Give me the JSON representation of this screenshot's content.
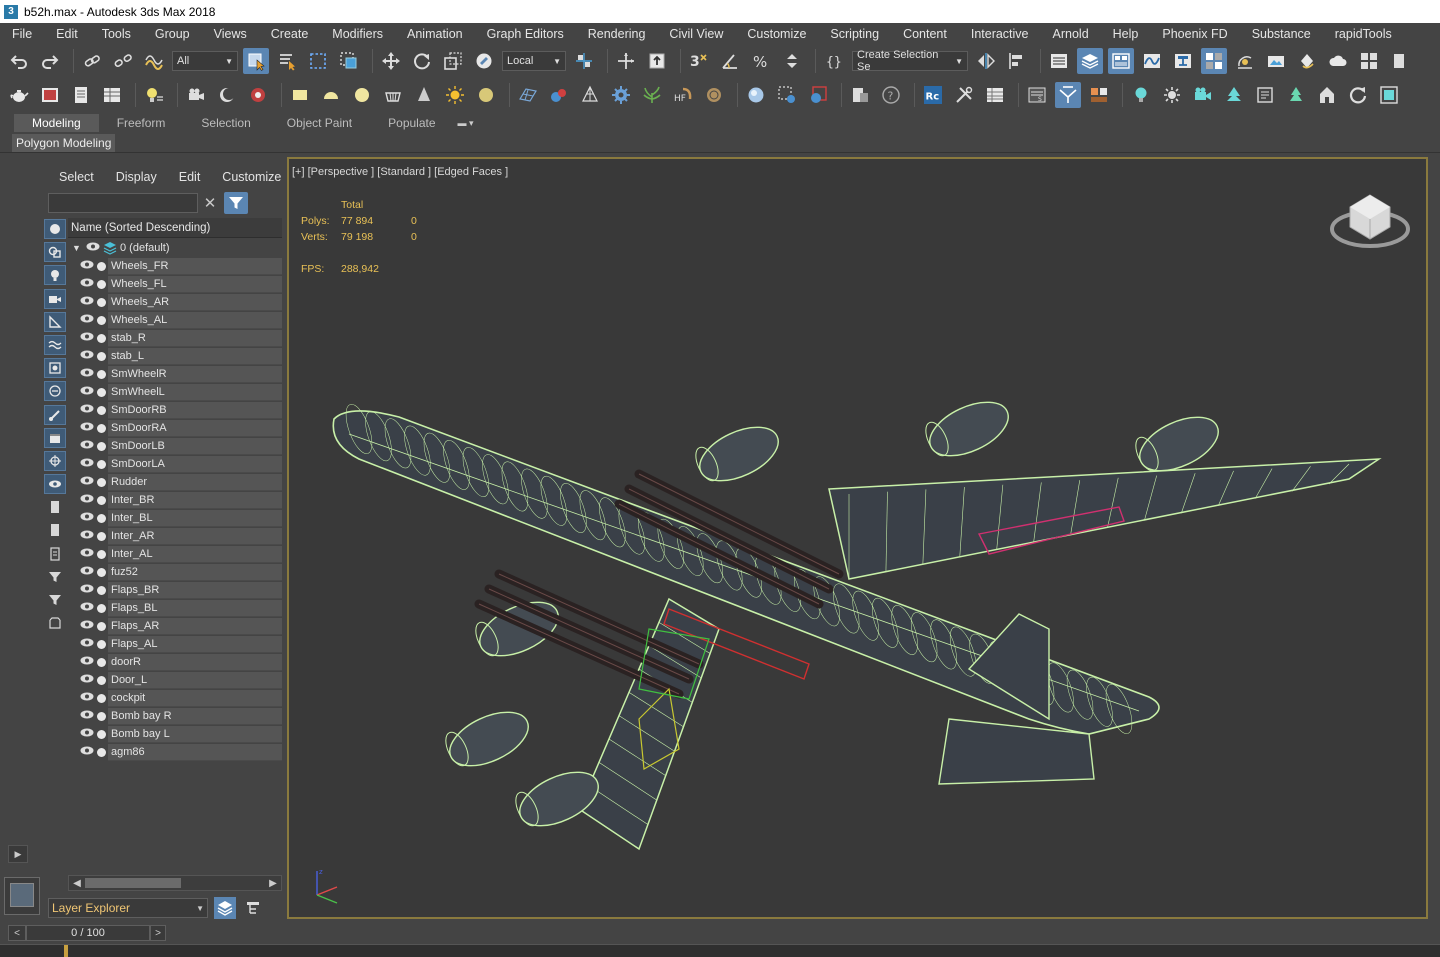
{
  "window": {
    "title": "b52h.max - Autodesk 3ds Max 2018",
    "icon_glyph": "3"
  },
  "menu": [
    "File",
    "Edit",
    "Tools",
    "Group",
    "Views",
    "Create",
    "Modifiers",
    "Animation",
    "Graph Editors",
    "Rendering",
    "Civil View",
    "Customize",
    "Scripting",
    "Content",
    "Interactive",
    "Arnold",
    "Help",
    "Phoenix FD",
    "Substance",
    "rapidTools"
  ],
  "toolbar": {
    "selection_filter": "All",
    "reference_coord": "Local",
    "named_selection": "Create Selection Se"
  },
  "ribbon": {
    "tabs": [
      "Modeling",
      "Freeform",
      "Selection",
      "Object Paint",
      "Populate"
    ],
    "active_tab": "Modeling",
    "panel_label": "Polygon Modeling"
  },
  "explorer": {
    "menu": [
      "Select",
      "Display",
      "Edit",
      "Customize"
    ],
    "column_header": "Name (Sorted Descending)",
    "layer_name": "0 (default)",
    "objects": [
      "Wheels_FR",
      "Wheels_FL",
      "Wheels_AR",
      "Wheels_AL",
      "stab_R",
      "stab_L",
      "SmWheelR",
      "SmWheelL",
      "SmDoorRB",
      "SmDoorRA",
      "SmDoorLB",
      "SmDoorLA",
      "Rudder",
      "Inter_BR",
      "Inter_BL",
      "Inter_AR",
      "Inter_AL",
      "fuz52",
      "Flaps_BR",
      "Flaps_BL",
      "Flaps_AR",
      "Flaps_AL",
      "doorR",
      "Door_L",
      "cockpit",
      "Bomb bay R",
      "Bomb bay L",
      "agm86"
    ],
    "footer_dropdown": "Layer Explorer"
  },
  "viewport": {
    "label": "[+] [Perspective ] [Standard ] [Edged Faces ]",
    "stats_header": "Total",
    "polys_label": "Polys:",
    "polys_value": "77 894",
    "polys_selected": "0",
    "verts_label": "Verts:",
    "verts_value": "79 198",
    "verts_selected": "0",
    "fps_label": "FPS:",
    "fps_value": "288,942",
    "border_color": "#8a7a3e",
    "wire_color": "#c8f0a8"
  },
  "timeline": {
    "frame": "0 / 100",
    "prev": "<",
    "next": ">"
  }
}
